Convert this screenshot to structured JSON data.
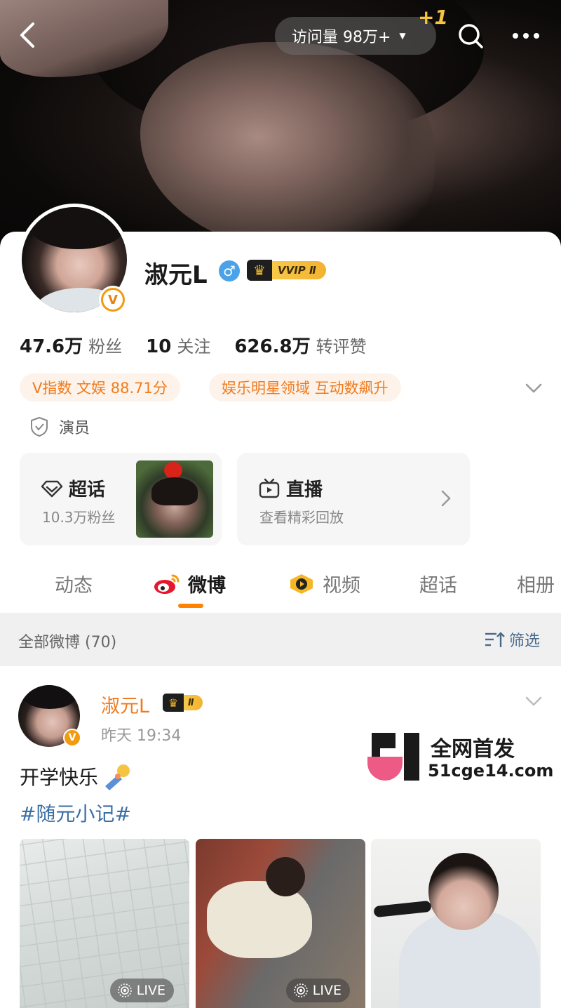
{
  "header": {
    "visits_label": "访问量 98万+",
    "plus_badge": "+1"
  },
  "profile": {
    "name": "淑元L",
    "vip_label": "VVIP Ⅱ",
    "stats": [
      {
        "num": "47.6万",
        "label": "粉丝"
      },
      {
        "num": "10",
        "label": "关注"
      },
      {
        "num": "626.8万",
        "label": "转评赞"
      }
    ],
    "tags": [
      "V指数 文娱 88.71分",
      "娱乐明星领域 互动数飙升"
    ],
    "certification": "演员"
  },
  "tiles": {
    "super_topic": {
      "title": "超话",
      "sub": "10.3万粉丝"
    },
    "live": {
      "title": "直播",
      "sub": "查看精彩回放"
    }
  },
  "tabs": [
    "动态",
    "微博",
    "视频",
    "超话",
    "相册"
  ],
  "feed": {
    "count_label": "全部微博 (70)",
    "filter_label": "筛选"
  },
  "post": {
    "author": "淑元L",
    "badge_label": "Ⅱ",
    "time": "昨天 19:34",
    "text": "开学快乐",
    "hashtag": "#随元小记#",
    "live_label": "LIVE"
  },
  "watermark": {
    "line1": "全网首发",
    "line2": "51cge14.com"
  },
  "colors": {
    "accent_orange": "#ff8200",
    "tag_text": "#f07b1e",
    "hashtag_blue": "#3a6ea5"
  }
}
